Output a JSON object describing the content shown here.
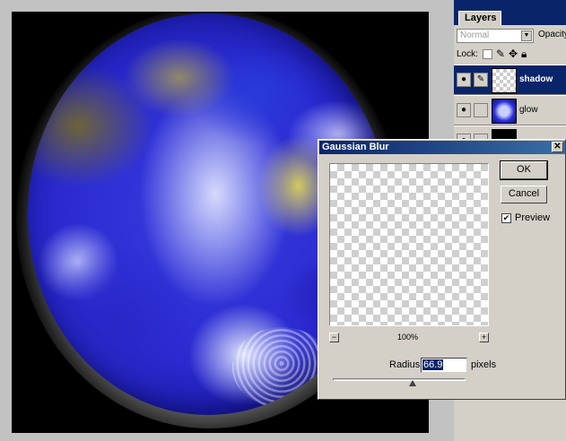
{
  "layers": {
    "tab_label": "Layers",
    "blend_mode": "Normal",
    "opacity_label": "Opacity",
    "lock_label": "Lock:",
    "items": [
      {
        "name": "shadow",
        "selected": true,
        "thumb": "checker"
      },
      {
        "name": "glow",
        "selected": false,
        "thumb": "planet"
      },
      {
        "name": "",
        "selected": false,
        "thumb": "black"
      }
    ]
  },
  "dialog": {
    "title": "Gaussian Blur",
    "close_label": "✕",
    "ok_label": "OK",
    "cancel_label": "Cancel",
    "preview_label": "Preview",
    "preview_checked": true,
    "zoom_out_label": "−",
    "zoom_in_label": "+",
    "zoom_level": "100%",
    "radius_label": "Radius:",
    "radius_value": "66.9",
    "radius_units": "pixels",
    "radius_slider_fraction": 0.6
  },
  "icons": {
    "eye": "eye-icon",
    "brush": "brush-icon",
    "move": "move-icon",
    "lock": "lock-icon"
  }
}
